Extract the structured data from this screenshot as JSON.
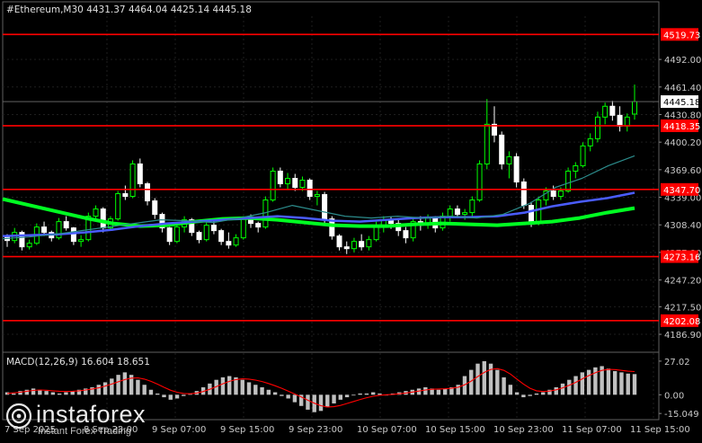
{
  "chart_data": [
    {
      "type": "candlestick",
      "title": "#Ethereum,M30  4431.37 4464.04 4425.14 4445.18",
      "symbol": "#Ethereum",
      "timeframe": "M30",
      "ohlc": {
        "open": 4431.37,
        "high": 4464.04,
        "low": 4425.14,
        "close": 4445.18
      },
      "colors": {
        "bull": "#00ff00",
        "bear": "#ffffff",
        "background": "#000000",
        "grid": "#1e1e1e"
      },
      "yticks": [
        "4492.00",
        "4461.40",
        "4430.80",
        "4400.20",
        "4369.60",
        "4339.00",
        "4308.40",
        "4277.80",
        "4247.20",
        "4217.50",
        "4186.90"
      ],
      "ylim": [
        4170,
        4540
      ],
      "x_ticks": [
        "7 Sep 2025",
        "8 Sep 23:00",
        "9 Sep 07:00",
        "9 Sep 15:00",
        "9 Sep 23:00",
        "10 Sep 07:00",
        "10 Sep 15:00",
        "10 Sep 23:00",
        "11 Sep 07:00",
        "11 Sep 15:00"
      ],
      "levels": [
        {
          "label": "4519.73",
          "value": 4519.73,
          "color": "#ff0000"
        },
        {
          "label": "4418.35",
          "value": 4418.35,
          "color": "#ff0000"
        },
        {
          "label": "4347.70",
          "value": 4347.7,
          "color": "#ff0000"
        },
        {
          "label": "4273.16",
          "value": 4273.16,
          "color": "#ff0000"
        },
        {
          "label": "4202.08",
          "value": 4202.08,
          "color": "#ff0000"
        }
      ],
      "current_price": {
        "label": "4445.18",
        "value": 4445.18
      },
      "series": [
        {
          "name": "",
          "color": "#00ff22",
          "width": 4,
          "values": [
            4337,
            4330,
            4323,
            4316,
            4310,
            4307,
            4308,
            4312,
            4315,
            4316,
            4314,
            4311,
            4308,
            4307,
            4307,
            4309,
            4310,
            4309,
            4308,
            4310,
            4312,
            4316,
            4322,
            4327
          ]
        },
        {
          "name": "",
          "color": "#4a5cff",
          "width": 2.5,
          "values": [
            4296,
            4297,
            4298,
            4300,
            4303,
            4307,
            4310,
            4312,
            4314,
            4316,
            4318,
            4316,
            4313,
            4312,
            4314,
            4316,
            4317,
            4317,
            4318,
            4322,
            4329,
            4334,
            4338,
            4344
          ]
        },
        {
          "name": "",
          "color": "#2c8c8c",
          "width": 1.2,
          "values": [
            4293,
            4295,
            4298,
            4302,
            4306,
            4310,
            4314,
            4313,
            4311,
            4316,
            4322,
            4330,
            4324,
            4318,
            4316,
            4318,
            4316,
            4318,
            4316,
            4320,
            4332,
            4350,
            4360,
            4374,
            4385
          ]
        }
      ],
      "candles": [
        [
          4295,
          4298,
          4284,
          4291
        ],
        [
          4291,
          4305,
          4288,
          4300
        ],
        [
          4300,
          4302,
          4280,
          4284
        ],
        [
          4284,
          4292,
          4281,
          4288
        ],
        [
          4288,
          4310,
          4286,
          4306
        ],
        [
          4306,
          4312,
          4296,
          4300
        ],
        [
          4300,
          4302,
          4290,
          4294
        ],
        [
          4294,
          4316,
          4292,
          4312
        ],
        [
          4312,
          4318,
          4302,
          4305
        ],
        [
          4305,
          4306,
          4286,
          4290
        ],
        [
          4290,
          4297,
          4284,
          4292
        ],
        [
          4292,
          4322,
          4290,
          4318
        ],
        [
          4318,
          4330,
          4314,
          4326
        ],
        [
          4326,
          4328,
          4300,
          4305
        ],
        [
          4305,
          4318,
          4302,
          4315
        ],
        [
          4315,
          4346,
          4313,
          4343
        ],
        [
          4343,
          4352,
          4336,
          4340
        ],
        [
          4340,
          4380,
          4338,
          4376
        ],
        [
          4376,
          4382,
          4350,
          4354
        ],
        [
          4354,
          4356,
          4330,
          4335
        ],
        [
          4335,
          4338,
          4315,
          4320
        ],
        [
          4320,
          4322,
          4300,
          4305
        ],
        [
          4305,
          4306,
          4286,
          4290
        ],
        [
          4290,
          4310,
          4288,
          4306
        ],
        [
          4306,
          4318,
          4300,
          4314
        ],
        [
          4314,
          4316,
          4296,
          4300
        ],
        [
          4300,
          4302,
          4288,
          4292
        ],
        [
          4292,
          4312,
          4290,
          4308
        ],
        [
          4308,
          4314,
          4298,
          4302
        ],
        [
          4302,
          4304,
          4286,
          4290
        ],
        [
          4290,
          4300,
          4282,
          4286
        ],
        [
          4286,
          4298,
          4284,
          4294
        ],
        [
          4294,
          4318,
          4292,
          4315
        ],
        [
          4315,
          4320,
          4305,
          4310
        ],
        [
          4310,
          4312,
          4300,
          4306
        ],
        [
          4306,
          4340,
          4304,
          4336
        ],
        [
          4336,
          4372,
          4334,
          4368
        ],
        [
          4368,
          4372,
          4350,
          4354
        ],
        [
          4354,
          4366,
          4348,
          4360
        ],
        [
          4360,
          4365,
          4346,
          4350
        ],
        [
          4350,
          4362,
          4346,
          4358
        ],
        [
          4358,
          4360,
          4336,
          4340
        ],
        [
          4340,
          4346,
          4330,
          4342
        ],
        [
          4342,
          4345,
          4310,
          4315
        ],
        [
          4315,
          4318,
          4292,
          4296
        ],
        [
          4296,
          4298,
          4280,
          4284
        ],
        [
          4284,
          4290,
          4276,
          4282
        ],
        [
          4282,
          4294,
          4278,
          4290
        ],
        [
          4290,
          4298,
          4280,
          4284
        ],
        [
          4284,
          4296,
          4280,
          4292
        ],
        [
          4292,
          4312,
          4290,
          4308
        ],
        [
          4308,
          4318,
          4300,
          4314
        ],
        [
          4314,
          4318,
          4304,
          4310
        ],
        [
          4310,
          4314,
          4296,
          4302
        ],
        [
          4302,
          4306,
          4288,
          4294
        ],
        [
          4294,
          4316,
          4290,
          4312
        ],
        [
          4312,
          4318,
          4302,
          4308
        ],
        [
          4308,
          4320,
          4304,
          4316
        ],
        [
          4316,
          4318,
          4300,
          4305
        ],
        [
          4305,
          4322,
          4302,
          4318
        ],
        [
          4318,
          4330,
          4312,
          4326
        ],
        [
          4326,
          4330,
          4316,
          4320
        ],
        [
          4320,
          4326,
          4314,
          4322
        ],
        [
          4322,
          4340,
          4318,
          4336
        ],
        [
          4336,
          4380,
          4334,
          4376
        ],
        [
          4376,
          4448,
          4370,
          4420
        ],
        [
          4420,
          4440,
          4400,
          4408
        ],
        [
          4408,
          4412,
          4370,
          4376
        ],
        [
          4376,
          4390,
          4360,
          4384
        ],
        [
          4384,
          4388,
          4350,
          4356
        ],
        [
          4356,
          4360,
          4326,
          4330
        ],
        [
          4330,
          4334,
          4306,
          4312
        ],
        [
          4312,
          4340,
          4308,
          4336
        ],
        [
          4336,
          4350,
          4330,
          4346
        ],
        [
          4346,
          4352,
          4336,
          4340
        ],
        [
          4340,
          4350,
          4336,
          4346
        ],
        [
          4346,
          4372,
          4344,
          4368
        ],
        [
          4368,
          4378,
          4360,
          4374
        ],
        [
          4374,
          4400,
          4372,
          4396
        ],
        [
          4396,
          4410,
          4390,
          4404
        ],
        [
          4404,
          4434,
          4400,
          4428
        ],
        [
          4428,
          4444,
          4420,
          4440
        ],
        [
          4440,
          4446,
          4424,
          4430
        ],
        [
          4430,
          4440,
          4412,
          4418
        ],
        [
          4418,
          4432,
          4412,
          4428
        ],
        [
          4431.37,
          4464.04,
          4425.14,
          4445.18
        ]
      ]
    },
    {
      "type": "bar",
      "title": "MACD(12,26,9) 16.604 18.651",
      "yticks": [
        "27.02",
        "0.00",
        "-15.049"
      ],
      "ylim": [
        -20,
        32
      ],
      "colors": {
        "histogram": "#c0c0c0",
        "signal": "#ff0000"
      },
      "histogram": [
        2,
        1,
        3,
        4,
        5,
        4,
        3,
        2,
        1,
        2,
        3,
        4,
        5,
        6,
        8,
        10,
        13,
        16,
        18,
        16,
        12,
        8,
        4,
        1,
        -2,
        -4,
        -3,
        -1,
        1,
        3,
        6,
        9,
        12,
        14,
        15,
        14,
        12,
        10,
        8,
        6,
        4,
        2,
        -1,
        -3,
        -6,
        -9,
        -12,
        -14,
        -13,
        -10,
        -7,
        -4,
        -2,
        0,
        1,
        1,
        2,
        1,
        0,
        1,
        2,
        3,
        4,
        5,
        6,
        5,
        4,
        5,
        6,
        8,
        15,
        20,
        25,
        27,
        25,
        20,
        14,
        8,
        2,
        -2,
        -1,
        1,
        2,
        4,
        6,
        9,
        12,
        15,
        18,
        20,
        22,
        23,
        21,
        19,
        18,
        17,
        16.6
      ],
      "signal": [
        1,
        1.5,
        2,
        2.8,
        3.5,
        3.8,
        3.6,
        3.2,
        2.8,
        2.6,
        2.8,
        3.2,
        3.8,
        4.6,
        5.6,
        7,
        8.6,
        10.4,
        12.2,
        13.4,
        13.6,
        12.6,
        10.8,
        8.5,
        6,
        3.6,
        2,
        1,
        0.8,
        1.4,
        2.6,
        4.4,
        6.6,
        8.8,
        10.8,
        12.2,
        12.8,
        12.6,
        11.8,
        10.6,
        9,
        7.2,
        5.2,
        3,
        0.6,
        -1.8,
        -4.4,
        -6.8,
        -8.8,
        -9.8,
        -9.6,
        -8.6,
        -7,
        -5.4,
        -3.8,
        -2.4,
        -1.2,
        -0.4,
        0,
        0.3,
        0.8,
        1.4,
        2.2,
        3,
        3.8,
        4.4,
        4.6,
        4.8,
        5.2,
        6,
        8,
        11,
        14.6,
        18,
        20.4,
        21,
        19.6,
        16.6,
        12.6,
        8.6,
        5.2,
        3.2,
        2.6,
        3,
        4,
        5.6,
        7.6,
        10,
        12.8,
        15.4,
        17.8,
        19.6,
        20.4,
        20.2,
        19.6,
        18.9,
        18.651
      ]
    }
  ],
  "watermark": {
    "name": "instaforex",
    "tagline": "Instant Forex Trading"
  }
}
